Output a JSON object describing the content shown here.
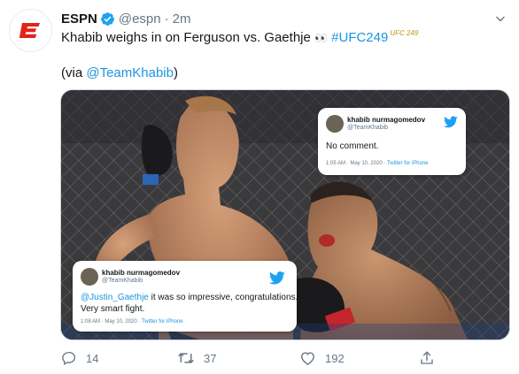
{
  "tweet": {
    "author_name": "ESPN",
    "handle": "@espn",
    "separator": "·",
    "time": "2m",
    "text_main": "Khabib weighs in on Ferguson vs. Gaethje",
    "text_emoji": "👀",
    "hashtag": "#UFC249",
    "hashtag_badge": "UFC 249",
    "via_prefix": "(via ",
    "via_link": "@TeamKhabib",
    "via_suffix": ")"
  },
  "card_top": {
    "name": "khabib nurmagomedov",
    "verified_icon": "verified-badge-icon",
    "handle": "@TeamKhabib",
    "body": "No comment.",
    "time": "1:05 AM · May 10, 2020 · ",
    "source": "Twitter for iPhone"
  },
  "card_bottom": {
    "name": "khabib nurmagomedov",
    "handle": "@TeamKhabib",
    "mention": "@Justin_Gaethje",
    "body_line1_rest": " it was so impressive, congratulations.",
    "body_line2": "Very smart fight.",
    "time": "1:08 AM · May 10, 2020 · ",
    "source": "Twitter for iPhone"
  },
  "actions": {
    "replies": "14",
    "retweets": "37",
    "likes": "192"
  },
  "colors": {
    "link": "#1b95e0",
    "espn_red": "#e2231a",
    "secondary_text": "#657786"
  }
}
